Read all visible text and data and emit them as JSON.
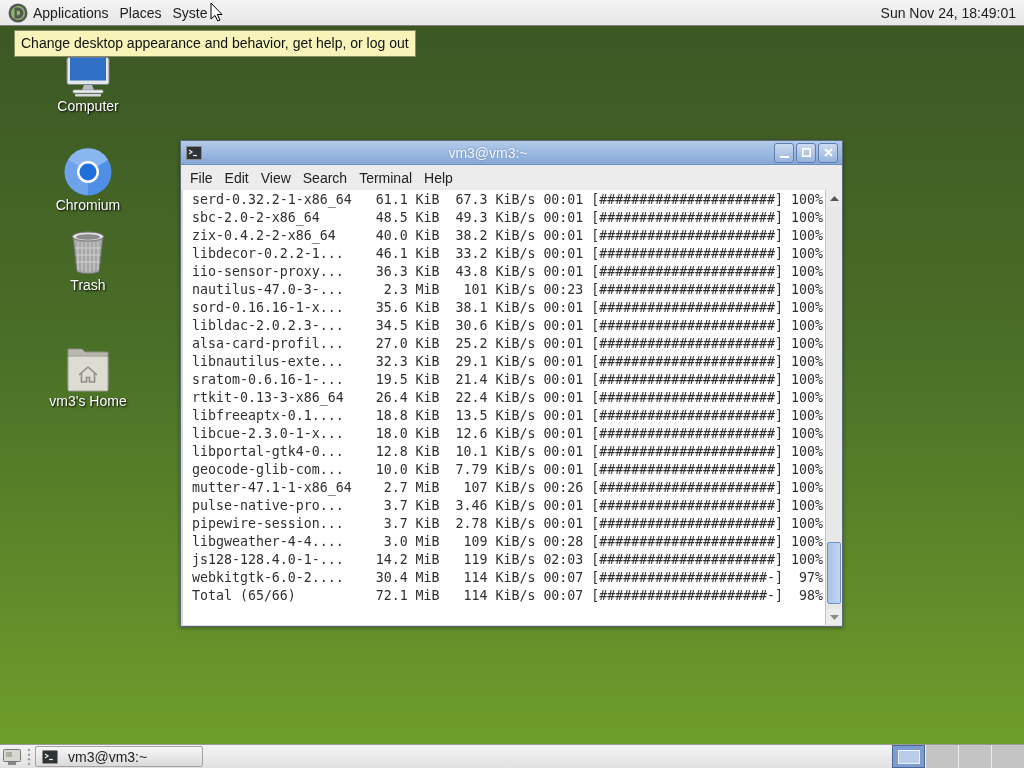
{
  "top_panel": {
    "menus": [
      {
        "label": "Applications"
      },
      {
        "label": "Places"
      },
      {
        "label": "Syste"
      }
    ],
    "clock": "Sun Nov 24, 18:49:01"
  },
  "tooltip": {
    "text": "Change desktop appearance and behavior, get help, or log out"
  },
  "desktop_icons": [
    {
      "kind": "computer",
      "label": "Computer"
    },
    {
      "kind": "browser",
      "label": "Chromium"
    },
    {
      "kind": "trash",
      "label": "Trash"
    },
    {
      "kind": "home",
      "label": "vm3's Home"
    }
  ],
  "terminal": {
    "title": "vm3@vm3:~",
    "menu": [
      {
        "label": "File"
      },
      {
        "label": "Edit"
      },
      {
        "label": "View"
      },
      {
        "label": "Search"
      },
      {
        "label": "Terminal"
      },
      {
        "label": "Help"
      }
    ],
    "rows": [
      {
        "name": "serd-0.32.2-1-x86_64",
        "size": "61.1 KiB",
        "rate": "67.3 KiB/s",
        "time": "00:01",
        "bar": "[######################]",
        "percent": "100%"
      },
      {
        "name": "sbc-2.0-2-x86_64",
        "size": "48.5 KiB",
        "rate": "49.3 KiB/s",
        "time": "00:01",
        "bar": "[######################]",
        "percent": "100%"
      },
      {
        "name": "zix-0.4.2-2-x86_64",
        "size": "40.0 KiB",
        "rate": "38.2 KiB/s",
        "time": "00:01",
        "bar": "[######################]",
        "percent": "100%"
      },
      {
        "name": "libdecor-0.2.2-1...",
        "size": "46.1 KiB",
        "rate": "33.2 KiB/s",
        "time": "00:01",
        "bar": "[######################]",
        "percent": "100%"
      },
      {
        "name": "iio-sensor-proxy...",
        "size": "36.3 KiB",
        "rate": "43.8 KiB/s",
        "time": "00:01",
        "bar": "[######################]",
        "percent": "100%"
      },
      {
        "name": "nautilus-47.0-3-...",
        "size": "2.3 MiB",
        "rate": "101 KiB/s",
        "time": "00:23",
        "bar": "[######################]",
        "percent": "100%"
      },
      {
        "name": "sord-0.16.16-1-x...",
        "size": "35.6 KiB",
        "rate": "38.1 KiB/s",
        "time": "00:01",
        "bar": "[######################]",
        "percent": "100%"
      },
      {
        "name": "libldac-2.0.2.3-...",
        "size": "34.5 KiB",
        "rate": "30.6 KiB/s",
        "time": "00:01",
        "bar": "[######################]",
        "percent": "100%"
      },
      {
        "name": "alsa-card-profil...",
        "size": "27.0 KiB",
        "rate": "25.2 KiB/s",
        "time": "00:01",
        "bar": "[######################]",
        "percent": "100%"
      },
      {
        "name": "libnautilus-exte...",
        "size": "32.3 KiB",
        "rate": "29.1 KiB/s",
        "time": "00:01",
        "bar": "[######################]",
        "percent": "100%"
      },
      {
        "name": "sratom-0.6.16-1-...",
        "size": "19.5 KiB",
        "rate": "21.4 KiB/s",
        "time": "00:01",
        "bar": "[######################]",
        "percent": "100%"
      },
      {
        "name": "rtkit-0.13-3-x86_64",
        "size": "26.4 KiB",
        "rate": "22.4 KiB/s",
        "time": "00:01",
        "bar": "[######################]",
        "percent": "100%"
      },
      {
        "name": "libfreeaptx-0.1....",
        "size": "18.8 KiB",
        "rate": "13.5 KiB/s",
        "time": "00:01",
        "bar": "[######################]",
        "percent": "100%"
      },
      {
        "name": "libcue-2.3.0-1-x...",
        "size": "18.0 KiB",
        "rate": "12.6 KiB/s",
        "time": "00:01",
        "bar": "[######################]",
        "percent": "100%"
      },
      {
        "name": "libportal-gtk4-0...",
        "size": "12.8 KiB",
        "rate": "10.1 KiB/s",
        "time": "00:01",
        "bar": "[######################]",
        "percent": "100%"
      },
      {
        "name": "geocode-glib-com...",
        "size": "10.0 KiB",
        "rate": "7.79 KiB/s",
        "time": "00:01",
        "bar": "[######################]",
        "percent": "100%"
      },
      {
        "name": "mutter-47.1-1-x86_64",
        "size": "2.7 MiB",
        "rate": "107 KiB/s",
        "time": "00:26",
        "bar": "[######################]",
        "percent": "100%"
      },
      {
        "name": "pulse-native-pro...",
        "size": "3.7 KiB",
        "rate": "3.46 KiB/s",
        "time": "00:01",
        "bar": "[######################]",
        "percent": "100%"
      },
      {
        "name": "pipewire-session...",
        "size": "3.7 KiB",
        "rate": "2.78 KiB/s",
        "time": "00:01",
        "bar": "[######################]",
        "percent": "100%"
      },
      {
        "name": "libgweather-4-4....",
        "size": "3.0 MiB",
        "rate": "109 KiB/s",
        "time": "00:28",
        "bar": "[######################]",
        "percent": "100%"
      },
      {
        "name": "js128-128.4.0-1-...",
        "size": "14.2 MiB",
        "rate": "119 KiB/s",
        "time": "02:03",
        "bar": "[######################]",
        "percent": "100%"
      },
      {
        "name": "webkitgtk-6.0-2....",
        "size": "30.4 MiB",
        "rate": "114 KiB/s",
        "time": "00:07",
        "bar": "[#####################-]",
        "percent": "97%"
      },
      {
        "name": "Total (65/66)",
        "size": "72.1 MiB",
        "rate": "114 KiB/s",
        "time": "00:07",
        "bar": "[#####################-]",
        "percent": "98%"
      }
    ]
  },
  "bottom_panel": {
    "tasks": [
      {
        "label": "vm3@vm3:~",
        "selected": false
      }
    ],
    "workspaces": [
      {
        "selected": true
      },
      {
        "selected": false
      },
      {
        "selected": false
      },
      {
        "selected": false
      }
    ]
  }
}
